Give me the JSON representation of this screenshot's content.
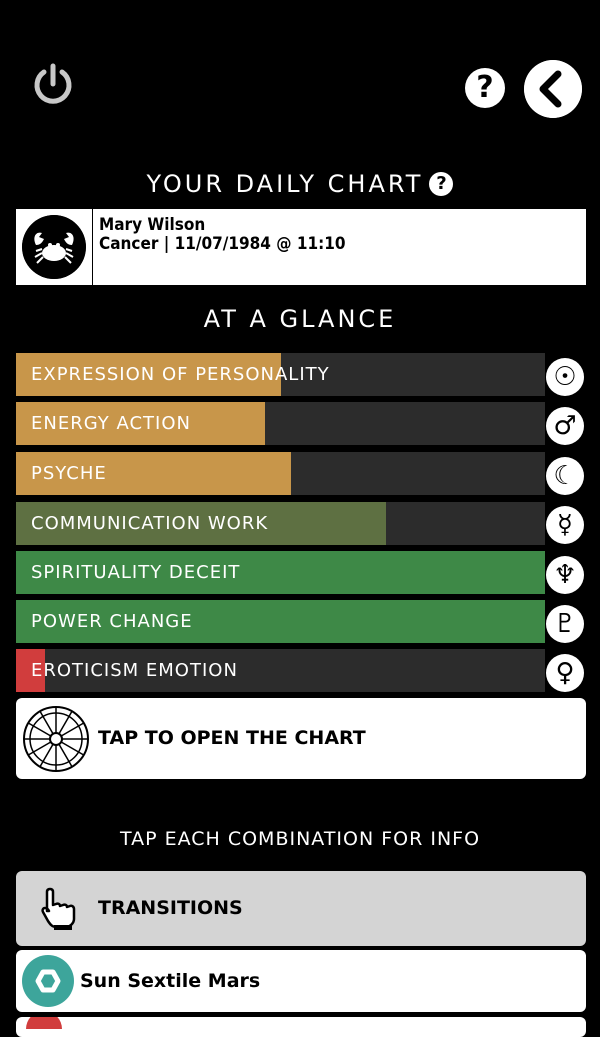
{
  "header": {
    "title": "YOUR DAILY CHART",
    "title_help_glyph": "?",
    "help_glyph": "?"
  },
  "profile": {
    "name": "Mary Wilson",
    "info": "Cancer | 11/07/1984 @ 11:10",
    "avatar_icon": "cancer-crab-icon"
  },
  "glance": {
    "title": "AT A GLANCE",
    "bars": [
      {
        "label": "EXPRESSION OF PERSONALITY",
        "fraction": 0.5,
        "color": "#c8964a",
        "planet_icon": "sun-icon",
        "glyph": "☉"
      },
      {
        "label": "ENERGY ACTION",
        "fraction": 0.47,
        "color": "#c8964a",
        "planet_icon": "mars-icon",
        "glyph": "♂"
      },
      {
        "label": "PSYCHE",
        "fraction": 0.52,
        "color": "#c8964a",
        "planet_icon": "moon-icon",
        "glyph": "☾"
      },
      {
        "label": "COMMUNICATION WORK",
        "fraction": 0.7,
        "color": "#5e7042",
        "planet_icon": "mercury-icon",
        "glyph": "☿"
      },
      {
        "label": "SPIRITUALITY DECEIT",
        "fraction": 1.0,
        "color": "#3e8947",
        "planet_icon": "neptune-icon",
        "glyph": "♆"
      },
      {
        "label": "POWER CHANGE",
        "fraction": 1.0,
        "color": "#3e8947",
        "planet_icon": "pluto-icon",
        "glyph": "♇"
      },
      {
        "label": "EROTICISM EMOTION",
        "fraction": 0.055,
        "color": "#d13d3d",
        "planet_icon": "venus-icon",
        "glyph": "♀"
      }
    ]
  },
  "open_chart": {
    "label": "TAP TO OPEN THE CHART",
    "icon": "zodiac-wheel-icon"
  },
  "combinations": {
    "title": "TAP EACH COMBINATION FOR INFO",
    "transitions_label": "TRANSITIONS",
    "transitions_icon": "pointing-hand-icon",
    "items": [
      {
        "label": "Sun Sextile Mars",
        "icon": "sextile-hexagon-icon",
        "color": "#3da59b"
      }
    ]
  }
}
